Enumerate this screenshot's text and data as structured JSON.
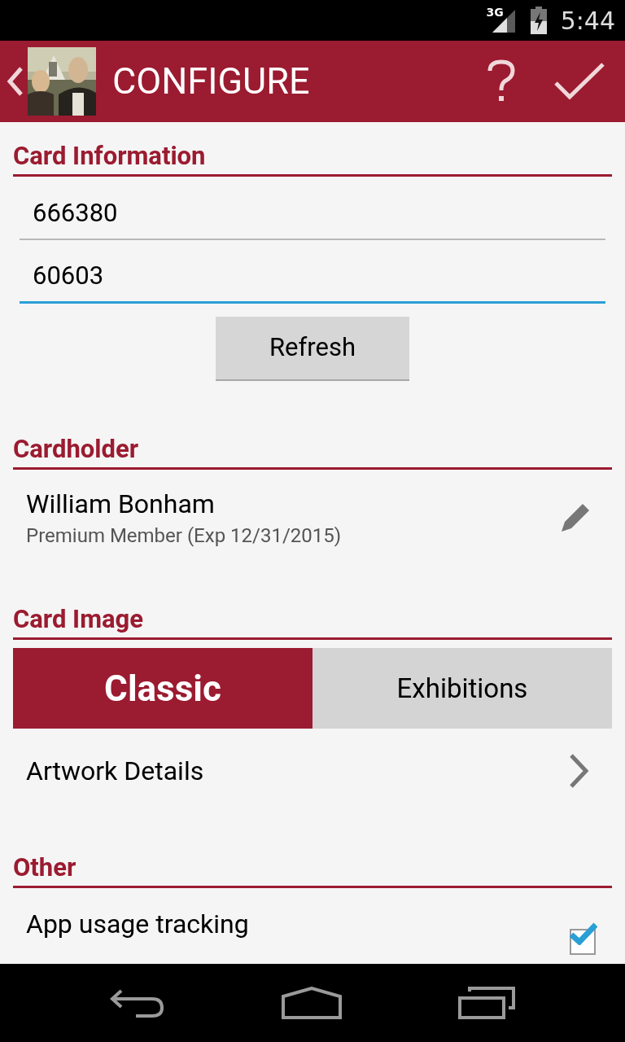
{
  "status_bar": {
    "network": "3G",
    "time": "5:44"
  },
  "app_bar": {
    "title": "CONFIGURE"
  },
  "card_information": {
    "heading": "Card Information",
    "fields": [
      {
        "value": "666380",
        "focused": false
      },
      {
        "value": "60603",
        "focused": true
      }
    ],
    "refresh_button": "Refresh"
  },
  "cardholder": {
    "heading": "Cardholder",
    "name": "William Bonham",
    "membership": "Premium Member (Exp 12/31/2015)"
  },
  "card_image": {
    "heading": "Card Image",
    "tabs": [
      {
        "label": "Classic",
        "selected": true
      },
      {
        "label": "Exhibitions",
        "selected": false
      }
    ],
    "details_row": "Artwork Details"
  },
  "other": {
    "heading": "Other",
    "settings": [
      {
        "title": "App usage tracking",
        "checked": true
      }
    ]
  }
}
